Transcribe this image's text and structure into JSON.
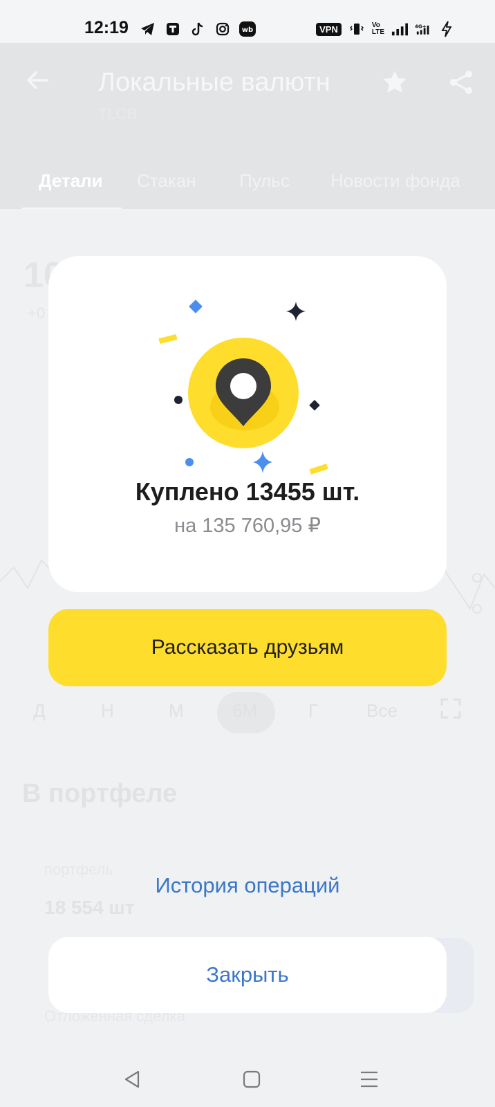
{
  "status_bar": {
    "time": "12:19",
    "vpn": "VPN",
    "volte_top": "Vo",
    "volte_bottom": "LTE",
    "network": "4G+"
  },
  "background": {
    "header_title": "Локальные валютн",
    "header_subtitle": "TLCB",
    "tabs": [
      "Детали",
      "Стакан",
      "Пульс",
      "Новости фонда"
    ],
    "big_number": "10",
    "small_change": "+0",
    "periods": [
      "Д",
      "Н",
      "М",
      "6М",
      "Г",
      "Все"
    ],
    "section_title": "В портфеле",
    "muted_label": "портфель",
    "holdings": "18 554 шт",
    "muted_footer": "Отложенная сделка"
  },
  "modal": {
    "title": "Куплено 13455 шт.",
    "subtitle": "на 135 760,95 ₽",
    "share_label": "Рассказать друзьям",
    "history_label": "История операций",
    "close_label": "Закрыть"
  },
  "colors": {
    "accent_yellow": "#ffdd2d",
    "link_blue": "#3a77c9",
    "pin_dark": "#3c3c3c",
    "sparkle_blue": "#4a8ef0"
  }
}
